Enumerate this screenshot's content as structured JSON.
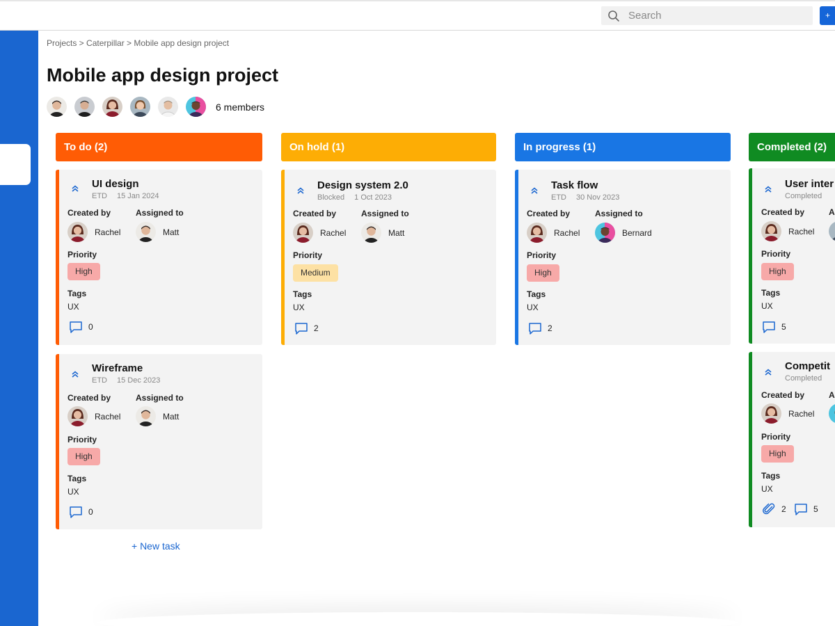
{
  "search": {
    "placeholder": "Search",
    "plus_label": "+"
  },
  "breadcrumb": "Projects > Caterpillar > Mobile app design project",
  "page_title": "Mobile app design project",
  "members": {
    "count_label": "6 members",
    "avatars": [
      "#3a2f2a",
      "#2f2f2f",
      "#8b1c2c",
      "#6a4a3a",
      "#e9e9e9",
      "#3b2a5a"
    ]
  },
  "new_task_label": "+ New task",
  "colors": {
    "todo": "#ff5c05",
    "onhold": "#fdad05",
    "inprogress": "#1976e4",
    "completed": "#108b22",
    "high": "#f7a9a8",
    "medium": "#fde1a4"
  },
  "columns": [
    {
      "title": "To do (2)",
      "cards": [
        {
          "title": "UI design",
          "meta_left": "ETD",
          "meta_right": "15 Jan 2024",
          "created_label": "Created by",
          "assigned_label": "Assigned to",
          "created_by": "Rachel",
          "assigned_to": "Matt",
          "priority_label": "Priority",
          "priority": "High",
          "tags_label": "Tags",
          "tags": "UX",
          "comments": "0"
        },
        {
          "title": "Wireframe",
          "meta_left": "ETD",
          "meta_right": "15 Dec 2023",
          "created_label": "Created by",
          "assigned_label": "Assigned to",
          "created_by": "Rachel",
          "assigned_to": "Matt",
          "priority_label": "Priority",
          "priority": "High",
          "tags_label": "Tags",
          "tags": "UX",
          "comments": "0"
        }
      ]
    },
    {
      "title": "On hold (1)",
      "cards": [
        {
          "title": "Design system 2.0",
          "meta_left": "Blocked",
          "meta_right": "1 Oct 2023",
          "created_label": "Created by",
          "assigned_label": "Assigned to",
          "created_by": "Rachel",
          "assigned_to": "Matt",
          "priority_label": "Priority",
          "priority": "Medium",
          "tags_label": "Tags",
          "tags": "UX",
          "comments": "2"
        }
      ]
    },
    {
      "title": "In progress (1)",
      "cards": [
        {
          "title": "Task flow",
          "meta_left": "ETD",
          "meta_right": "30 Nov 2023",
          "created_label": "Created by",
          "assigned_label": "Assigned to",
          "created_by": "Rachel",
          "assigned_to": "Bernard",
          "priority_label": "Priority",
          "priority": "High",
          "tags_label": "Tags",
          "tags": "UX",
          "comments": "2"
        }
      ]
    },
    {
      "title": "Completed (2)",
      "cards": [
        {
          "title": "User inter",
          "meta_left": "Completed",
          "created_label": "Created by",
          "assigned_label": "A",
          "created_by": "Rachel",
          "priority_label": "Priority",
          "priority": "High",
          "tags_label": "Tags",
          "tags": "UX",
          "comments": "5"
        },
        {
          "title": "Competit",
          "meta_left": "Completed",
          "created_label": "Created by",
          "assigned_label": "A",
          "created_by": "Rachel",
          "priority_label": "Priority",
          "priority": "High",
          "tags_label": "Tags",
          "tags": "UX",
          "attachments": "2",
          "comments": "5"
        }
      ]
    }
  ]
}
